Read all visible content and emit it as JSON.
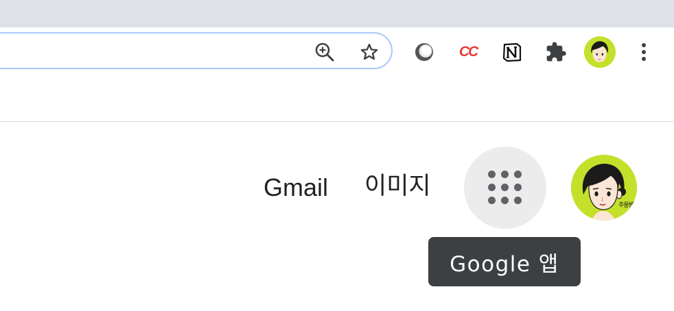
{
  "browser": {
    "omnibox": {
      "zoom_icon": "zoom-in-icon",
      "bookmark_icon": "star-icon"
    },
    "extensions": [
      {
        "name": "circle-extension-icon"
      },
      {
        "name": "cc-extension-icon",
        "label": "CC",
        "color": "#e53935"
      },
      {
        "name": "notion-icon",
        "label": "N"
      },
      {
        "name": "puzzle-icon"
      }
    ],
    "profile_avatar_name": "profile-avatar",
    "menu_icon": "more-vert-icon",
    "colors": {
      "tabstrip": "#dee1e6",
      "omnibox_border": "#a8c7fa",
      "avatar_bg": "#c5e02b"
    }
  },
  "google_header": {
    "gmail_label": "Gmail",
    "images_label": "이미지",
    "apps_icon": "apps-grid-icon",
    "avatar_caption": "주용쌤",
    "tooltip": "Google 앱",
    "colors": {
      "apps_button_bg": "#ececec",
      "tooltip_bg": "#3c4043"
    }
  }
}
